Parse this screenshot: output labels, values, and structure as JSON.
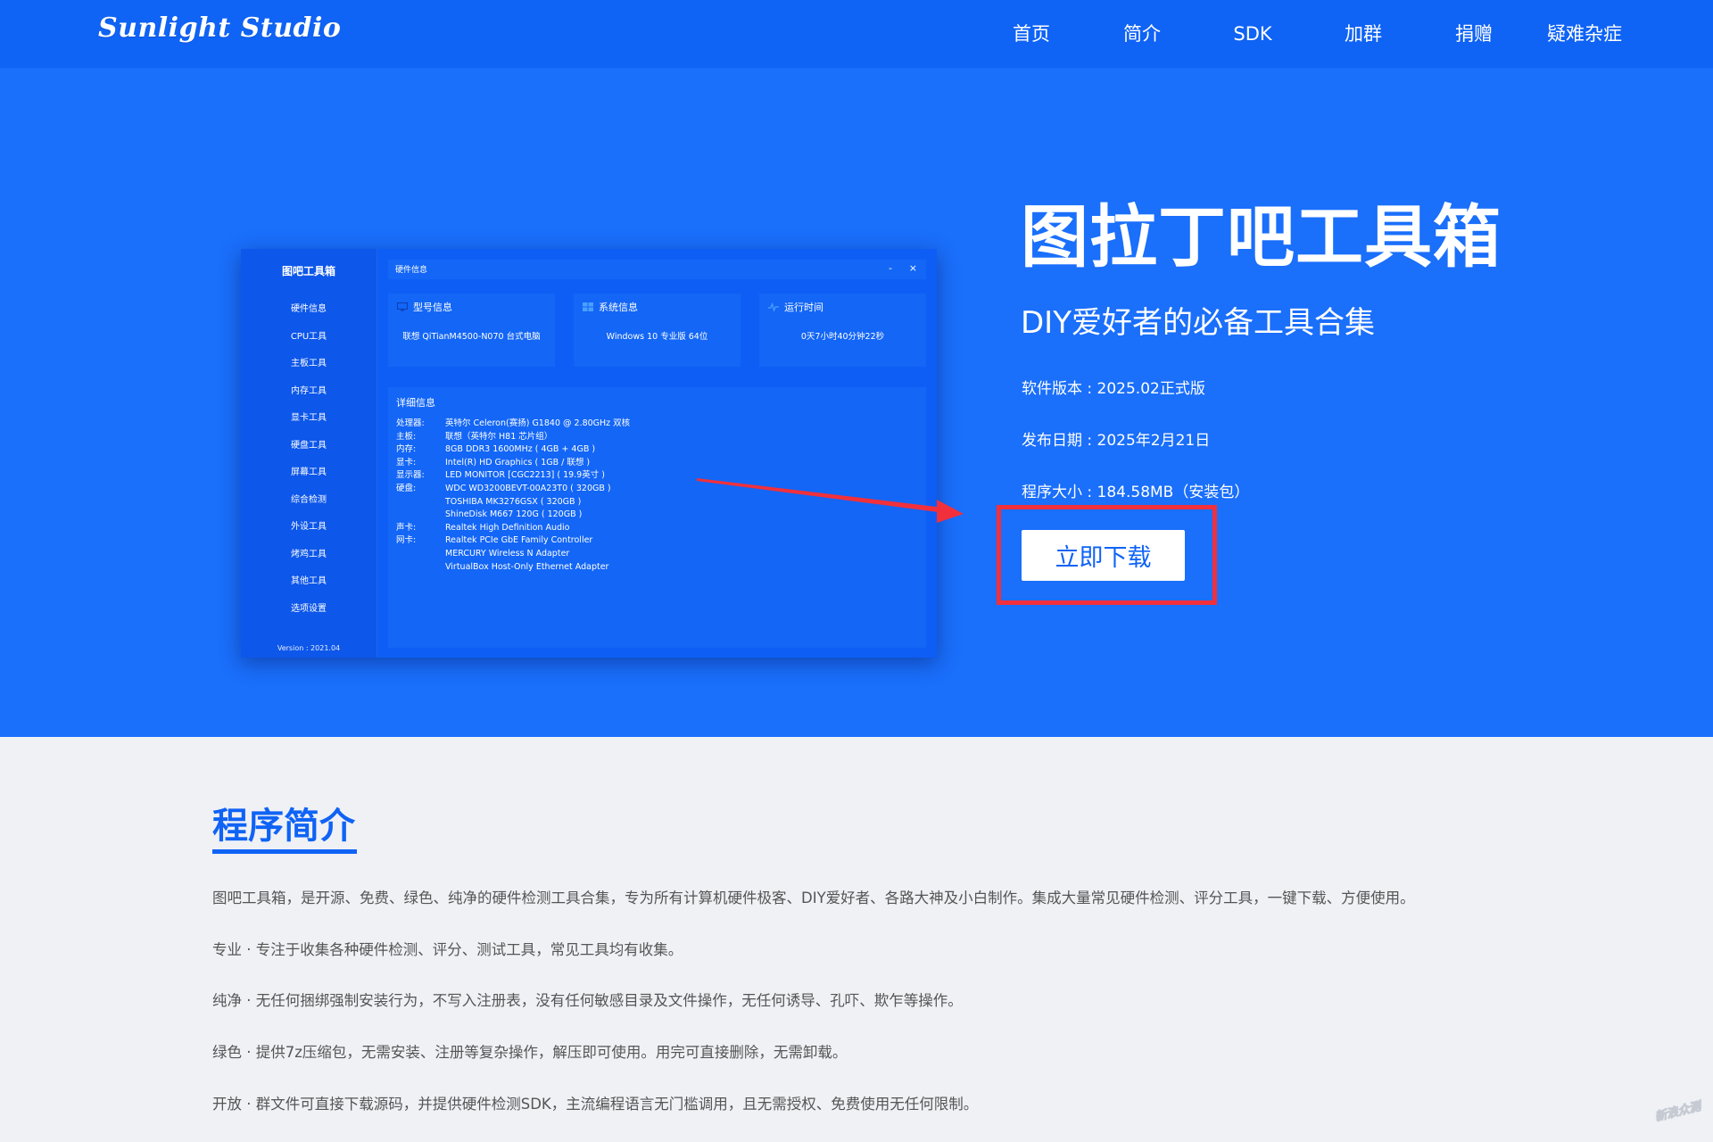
{
  "nav": {
    "brand": "Sunlight Studio",
    "items": [
      "首页",
      "简介",
      "SDK",
      "加群",
      "捐赠",
      "疑难杂症"
    ]
  },
  "app": {
    "title": "图吧工具箱",
    "sidebar": [
      "硬件信息",
      "CPU工具",
      "主板工具",
      "内存工具",
      "显卡工具",
      "硬盘工具",
      "屏幕工具",
      "综合检测",
      "外设工具",
      "烤鸡工具",
      "其他工具",
      "选项设置"
    ],
    "version": "Version : 2021.04",
    "window_title": "硬件信息",
    "minimize": "-",
    "close": "×",
    "cards": [
      {
        "title": "型号信息",
        "value": "联想 QiTianM4500-N070 台式电脑",
        "icon": "monitor-icon"
      },
      {
        "title": "系统信息",
        "value": "Windows 10 专业版 64位",
        "icon": "windows-icon"
      },
      {
        "title": "运行时间",
        "value": "0天7小时40分钟22秒",
        "icon": "pulse-icon"
      }
    ],
    "detail_title": "详细信息",
    "details": [
      {
        "label": "处理器:",
        "value": "英特尔 Celeron(赛扬) G1840 @ 2.80GHz 双核"
      },
      {
        "label": "主板:",
        "value": "联想（英特尔 H81 芯片组）"
      },
      {
        "label": "内存:",
        "value": "8GB DDR3 1600MHz ( 4GB + 4GB )"
      },
      {
        "label": "显卡:",
        "value": "Intel(R) HD Graphics ( 1GB / 联想 )"
      },
      {
        "label": "显示器:",
        "value": "LED MONITOR [CGC2213] ( 19.9英寸 )"
      },
      {
        "label": "硬盘:",
        "value": "WDC WD3200BEVT-00A23T0 ( 320GB )"
      },
      {
        "label": "",
        "value": "TOSHIBA MK3276GSX ( 320GB )"
      },
      {
        "label": "",
        "value": "ShineDisk M667 120G ( 120GB )"
      },
      {
        "label": "声卡:",
        "value": "Realtek High Definition Audio"
      },
      {
        "label": "网卡:",
        "value": "Realtek PCIe GbE Family Controller"
      },
      {
        "label": "",
        "value": "MERCURY Wireless N Adapter"
      },
      {
        "label": "",
        "value": "VirtualBox Host-Only Ethernet Adapter"
      }
    ]
  },
  "hero": {
    "title": "图拉丁吧工具箱",
    "subtitle": "DIY爱好者的必备工具合集",
    "version": "软件版本 : 2025.02正式版",
    "date": "发布日期 : 2025年2月21日",
    "size": "程序大小 : 184.58MB（安装包）",
    "download": "立即下载"
  },
  "intro": {
    "title": "程序简介",
    "paragraphs": [
      "图吧工具箱，是开源、免费、绿色、纯净的硬件检测工具合集，专为所有计算机硬件极客、DIY爱好者、各路大神及小白制作。集成大量常见硬件检测、评分工具，一键下载、方便使用。",
      "专业 · 专注于收集各种硬件检测、评分、测试工具，常见工具均有收集。",
      "纯净 · 无任何捆绑强制安装行为，不写入注册表，没有任何敏感目录及文件操作，无任何诱导、孔吓、欺乍等操作。",
      "绿色 · 提供7z压缩包，无需安装、注册等复杂操作，解压即可使用。用完可直接删除，无需卸载。",
      "开放 · 群文件可直接下载源码，并提供硬件检测SDK，主流编程语言无门槛调用，且无需授权、免费使用无任何限制。"
    ]
  },
  "watermark": "新浪众测",
  "colors": {
    "nav": "#0f63f5",
    "hero": "#1a6ffb",
    "accent": "#0f63f5",
    "highlight": "#f2303b"
  }
}
